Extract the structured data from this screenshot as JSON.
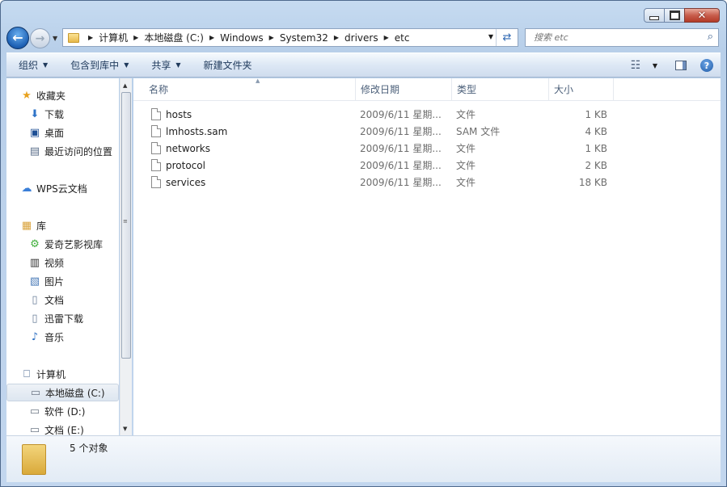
{
  "window": {
    "minimize_icon": "minimize-icon",
    "maximize_icon": "maximize-icon",
    "close_label": "✕"
  },
  "address": {
    "crumbs": [
      "计算机",
      "本地磁盘 (C:)",
      "Windows",
      "System32",
      "drivers",
      "etc"
    ]
  },
  "search": {
    "placeholder": "搜索 etc"
  },
  "toolbar": {
    "organize": "组织",
    "include_in_library": "包含到库中",
    "share": "共享",
    "new_folder": "新建文件夹"
  },
  "nav": {
    "favorites": "收藏夹",
    "downloads": "下载",
    "desktop": "桌面",
    "recent": "最近访问的位置",
    "wps": "WPS云文档",
    "libraries": "库",
    "iqiyi": "爱奇艺影视库",
    "videos": "视频",
    "pictures": "图片",
    "documents": "文档",
    "xunlei": "迅雷下载",
    "music": "音乐",
    "computer": "计算机",
    "drive_c": "本地磁盘 (C:)",
    "drive_d": "软件 (D:)",
    "drive_e": "文档 (E:)"
  },
  "columns": {
    "name": "名称",
    "date": "修改日期",
    "type": "类型",
    "size": "大小"
  },
  "files": [
    {
      "name": "hosts",
      "date": "2009/6/11 星期...",
      "type": "文件",
      "size": "1 KB"
    },
    {
      "name": "lmhosts.sam",
      "date": "2009/6/11 星期...",
      "type": "SAM 文件",
      "size": "4 KB"
    },
    {
      "name": "networks",
      "date": "2009/6/11 星期...",
      "type": "文件",
      "size": "1 KB"
    },
    {
      "name": "protocol",
      "date": "2009/6/11 星期...",
      "type": "文件",
      "size": "2 KB"
    },
    {
      "name": "services",
      "date": "2009/6/11 星期...",
      "type": "文件",
      "size": "18 KB"
    }
  ],
  "status": {
    "count": "5 个对象"
  }
}
